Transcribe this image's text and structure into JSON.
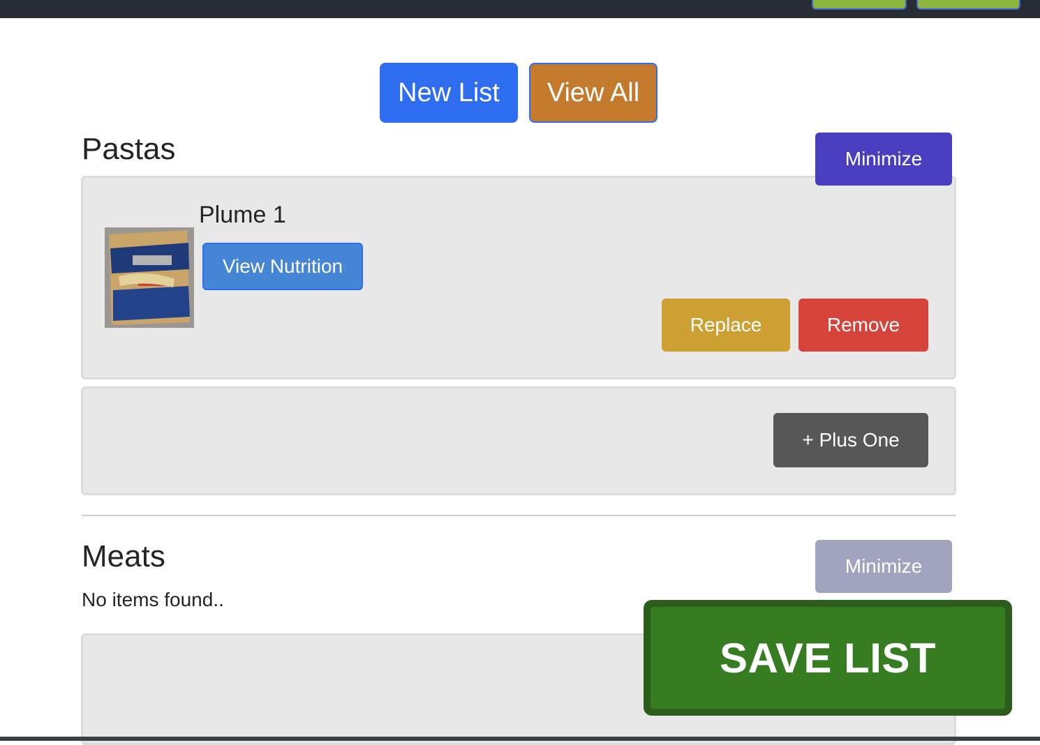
{
  "toolbar": {
    "new_list_label": "New List",
    "view_all_label": "View All"
  },
  "sections": [
    {
      "title": "Pastas",
      "minimize_label": "Minimize",
      "items": [
        {
          "name": "Plume 1",
          "view_nutrition_label": "View Nutrition",
          "replace_label": "Replace",
          "remove_label": "Remove"
        }
      ],
      "plus_one_label": "+ Plus One"
    },
    {
      "title": "Meats",
      "minimize_label": "Minimize",
      "empty_message": "No items found.."
    }
  ],
  "save_list_label": "SAVE LIST",
  "colors": {
    "new_list": "#2f6df0",
    "view_all": "#c47a2c",
    "minimize_active": "#4a3ec0",
    "minimize_faded": "#a1a3bf",
    "replace": "#cda033",
    "remove": "#d6433b",
    "plus_one": "#575757",
    "save_list": "#367d22"
  }
}
